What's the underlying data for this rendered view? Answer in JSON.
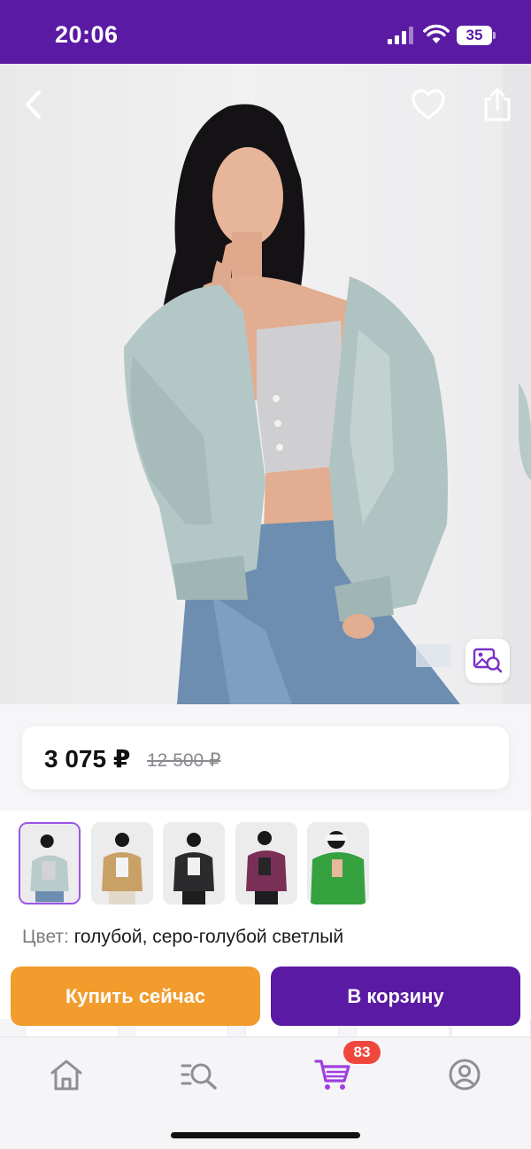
{
  "status_bar": {
    "time": "20:06",
    "battery": "35",
    "icons": [
      "signal-icon",
      "wifi-icon",
      "battery-icon"
    ]
  },
  "product": {
    "image_alt": "Женская стеганая куртка-бомбер голубого цвета",
    "price": "3 075 ₽",
    "old_price": "12 500 ₽",
    "color_label": "Цвет:",
    "color_value": "голубой, серо-голубой светлый",
    "color_variants": [
      {
        "jacket": "#b9cccb",
        "selected": true
      },
      {
        "jacket": "#c9a066",
        "selected": false
      },
      {
        "jacket": "#2b2b2e",
        "selected": false
      },
      {
        "jacket": "#7a2f57",
        "selected": false
      },
      {
        "jacket": "#35a13f",
        "selected": false
      }
    ]
  },
  "actions": {
    "buy_now": "Купить сейчас",
    "add_to_cart": "В корзину"
  },
  "bottom_nav": {
    "items": [
      "home-icon",
      "catalog-search-icon",
      "cart-icon",
      "profile-icon"
    ],
    "cart_badge": "83"
  },
  "colors": {
    "brand_purple": "#5a1aa3",
    "buy_orange": "#f29c2e",
    "badge_red": "#f0473c",
    "active_nav": "#a03fe0",
    "inactive_nav": "#8e8e96"
  }
}
